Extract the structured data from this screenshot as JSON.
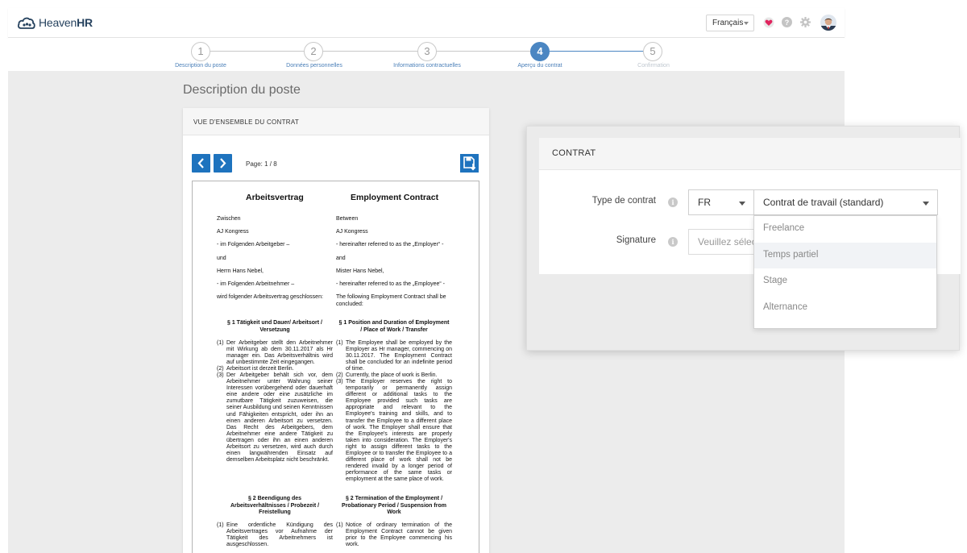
{
  "header": {
    "logo_prefix": "Heaven",
    "logo_suffix": "HR",
    "language": "Français",
    "icons": [
      "heart-icon",
      "help-icon",
      "gear-icon",
      "avatar"
    ]
  },
  "steps": [
    {
      "number": "1",
      "label": "Description du poste",
      "state": "done"
    },
    {
      "number": "2",
      "label": "Données personnelles",
      "state": "done"
    },
    {
      "number": "3",
      "label": "Informations contractuelles",
      "state": "done"
    },
    {
      "number": "4",
      "label": "Aperçu du contrat",
      "state": "active"
    },
    {
      "number": "5",
      "label": "Confirmation",
      "state": "future"
    }
  ],
  "page_title": "Description du poste",
  "overview": {
    "header": "VUE D'ENSEMBLE DU CONTRAT",
    "page_info": "Page: 1 / 8"
  },
  "document": {
    "title_de": "Arbeitsvertrag",
    "title_en": "Employment Contract",
    "de": {
      "between": "Zwischen",
      "company": "AJ Kongress",
      "employer_ref": "- im Folgenden Arbeitgeber –",
      "and": "und",
      "employee": "Herrn Hans Nebel,",
      "employee_ref": "- im Folgenden Arbeitnehmer –",
      "concluded": "wird folgender Arbeitsvertrag geschlossen:",
      "s1_title": "§ 1 Tätigkeit und Dauer/ Arbeitsort / Versetzung",
      "s1_p1": "Der Arbeitgeber stellt den Arbeitnehmer mit Wirkung ab dem 30.11.2017 als Hr manager ein. Das Arbeitsverhältnis wird auf unbestimmte Zeit eingegangen.",
      "s1_p2": "Arbeitsort ist derzeit Berlin.",
      "s1_p3": "Der Arbeitgeber behält sich vor, dem Arbeitnehmer unter Wahrung seiner Interessen vorübergehend oder dauerhaft eine andere oder eine zusätzliche im zumutbare Tätigkeit zuzuweisen, die seiner Ausbildung und seinen Kenntnissen und Fähigkeiten entspricht, oder ihn an einen anderen Arbeitsort zu versetzen. Das Recht des Arbeitgebers, dem Arbeitnehmer eine andere Tätigkeit zu übertragen oder ihn an einen anderen Arbeitsort zu versetzen, wird auch durch einen langwährenden Einsatz auf demselben Arbeitsplatz nicht beschränkt.",
      "s2_title": "§ 2 Beendigung des Arbeitsverhältnisses / Probezeit / Freistellung",
      "s2_p1": "Eine ordentliche Kündigung des Arbeitsvertrages vor Aufnahme der Tätigkeit des Arbeitnehmers ist ausgeschlossen."
    },
    "en": {
      "between": "Between",
      "company": "AJ Kongress",
      "employer_ref": "- hereinafter referred to as the „Employer“ -",
      "and": "and",
      "employee": "Mister Hans Nebel,",
      "employee_ref": "- hereinafter referred to as the „Employee“ -",
      "concluded": "The following Employment Contract shall be concluded:",
      "s1_title": "§ 1 Position and Duration of Employment / Place of Work / Transfer",
      "s1_p1": "The Employee shall be employed by the Employer as Hr manager, commencing on 30.11.2017. The Employment Contract shall be concluded for an indefinite period of time.",
      "s1_p2": "Currently, the place of work is Berlin.",
      "s1_p3": "The Employer reserves the right to temporarily or permanently assign different or additional tasks to the Employee provided such tasks are appropriate and relevant to the Employee's training and skills, and to transfer the Employee to a different place of work. The Employer shall ensure that the Employee's interests are properly taken into consideration. The Employer's right to assign different tasks to the Employee or to transfer the Employee to a different place of work shall not be rendered invalid by a longer period of performance of the same tasks or employment at the same place of work.",
      "s2_title": "§ 2 Termination of the Employment / Probationary Period / Suspension from Work",
      "s2_p1": "Notice of ordinary termination of the Employment Contract cannot be given prior to the Employee commencing his work."
    },
    "nums": [
      "(1)",
      "(2)",
      "(3)"
    ]
  },
  "contract_panel": {
    "title": "CONTRAT",
    "type_label": "Type de contrat",
    "country_value": "FR",
    "type_value": "Contrat de travail (standard)",
    "signature_label": "Signature",
    "signature_placeholder": "Veuillez sélectionner",
    "options": [
      "Freelance",
      "Temps partiel",
      "Stage",
      "Alternance"
    ]
  }
}
